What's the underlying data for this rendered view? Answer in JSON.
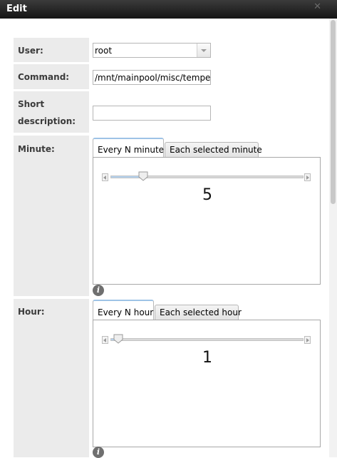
{
  "window": {
    "title": "Edit",
    "close_glyph": "✕"
  },
  "form": {
    "user": {
      "label": "User:",
      "value": "root"
    },
    "command": {
      "label": "Command:",
      "value": "/mnt/mainpool/misc/temperature"
    },
    "short_description": {
      "label_line1": "Short",
      "label_line2": "description:",
      "value": ""
    },
    "minute": {
      "label": "Minute:",
      "tabs": [
        "Every N minute",
        "Each selected minute"
      ],
      "active_tab": 0,
      "slider": {
        "value": "5",
        "fraction": 0.17
      }
    },
    "hour": {
      "label": "Hour:",
      "tabs": [
        "Every N hour",
        "Each selected hour"
      ],
      "active_tab": 0,
      "slider": {
        "value": "1",
        "fraction": 0.04
      }
    },
    "help_icon_glyph": "i"
  }
}
